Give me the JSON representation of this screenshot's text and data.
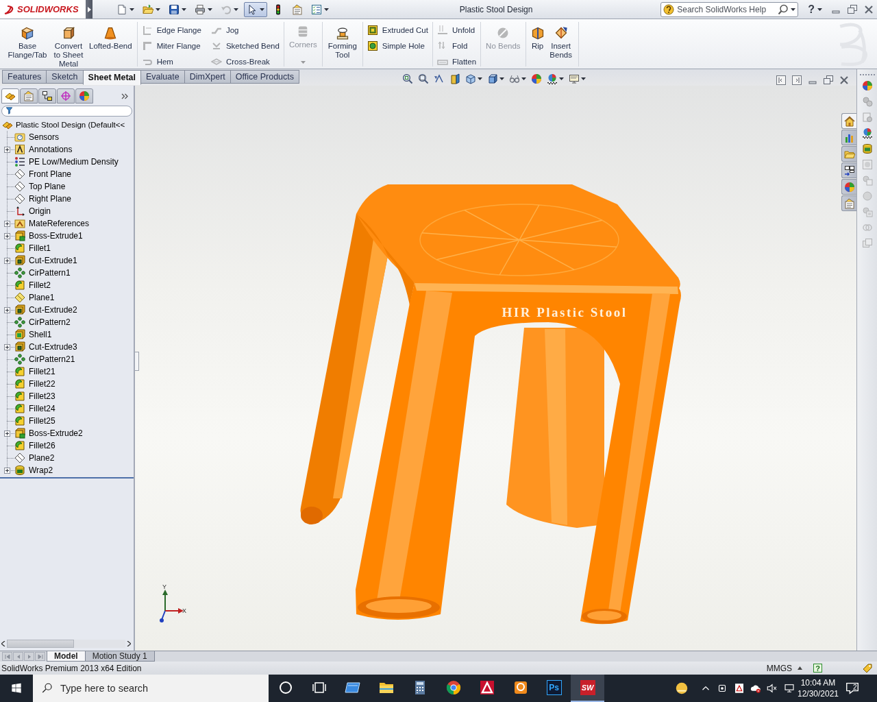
{
  "title_bar": {
    "logo": "SOLIDWORKS",
    "title": "Plastic Stool Design",
    "search": {
      "placeholder": "Search SolidWorks Help"
    },
    "help": "?",
    "quick_access": [
      {
        "kind": "new",
        "dropdown": true,
        "disabled": false,
        "pressed": false
      },
      {
        "kind": "open",
        "dropdown": true,
        "disabled": false,
        "pressed": false
      },
      {
        "kind": "save",
        "dropdown": true,
        "disabled": false,
        "pressed": false
      },
      {
        "kind": "print",
        "dropdown": true,
        "disabled": false,
        "pressed": false
      },
      {
        "kind": "undo",
        "dropdown": true,
        "disabled": true,
        "pressed": false
      },
      {
        "kind": "select",
        "dropdown": true,
        "disabled": false,
        "pressed": true
      },
      {
        "kind": "rebuild",
        "dropdown": false,
        "disabled": false,
        "pressed": false
      },
      {
        "kind": "properties",
        "dropdown": false,
        "disabled": false,
        "pressed": false
      },
      {
        "kind": "options",
        "dropdown": true,
        "disabled": false,
        "pressed": false
      }
    ]
  },
  "command_manager": {
    "groups": [
      {
        "kind": "large",
        "items": [
          {
            "kind": "base-flange",
            "label": "Base Flange/Tab",
            "disabled": false
          },
          {
            "kind": "convert",
            "label": "Convert to Sheet Metal",
            "disabled": false
          },
          {
            "kind": "lofted-bend",
            "label": "Lofted-Bend",
            "disabled": false
          }
        ]
      },
      {
        "kind": "small",
        "items": [
          {
            "kind": "edge-flange",
            "label": "Edge Flange",
            "disabled": true
          },
          {
            "kind": "miter-flange",
            "label": "Miter Flange",
            "disabled": true
          },
          {
            "kind": "hem",
            "label": "Hem",
            "disabled": true
          },
          {
            "kind": "jog",
            "label": "Jog",
            "disabled": true
          },
          {
            "kind": "sketched-bend",
            "label": "Sketched Bend",
            "disabled": true
          },
          {
            "kind": "cross-break",
            "label": "Cross-Break",
            "disabled": true
          }
        ]
      },
      {
        "kind": "flyout",
        "items": [
          {
            "kind": "corners",
            "label": "Corners",
            "disabled": true
          }
        ]
      },
      {
        "kind": "large",
        "items": [
          {
            "kind": "forming-tool",
            "label": "Forming Tool",
            "disabled": false
          }
        ]
      },
      {
        "kind": "small",
        "items": [
          {
            "kind": "extruded-cut",
            "label": "Extruded Cut",
            "disabled": false
          },
          {
            "kind": "simple-hole",
            "label": "Simple Hole",
            "disabled": false
          }
        ]
      },
      {
        "kind": "small",
        "items": [
          {
            "kind": "unfold",
            "label": "Unfold",
            "disabled": true
          },
          {
            "kind": "fold",
            "label": "Fold",
            "disabled": true
          },
          {
            "kind": "flatten",
            "label": "Flatten",
            "disabled": true
          }
        ]
      },
      {
        "kind": "large",
        "items": [
          {
            "kind": "no-bends",
            "label": "No Bends",
            "disabled": true
          }
        ]
      },
      {
        "kind": "large",
        "items": [
          {
            "kind": "rip",
            "label": "Rip",
            "disabled": false
          },
          {
            "kind": "insert-bends",
            "label": "Insert Bends",
            "disabled": false
          }
        ]
      }
    ]
  },
  "tabs": [
    {
      "label": "Features",
      "selected": false
    },
    {
      "label": "Sketch",
      "selected": false
    },
    {
      "label": "Sheet Metal",
      "selected": true
    },
    {
      "label": "Evaluate",
      "selected": false
    },
    {
      "label": "DimXpert",
      "selected": false
    },
    {
      "label": "Office Products",
      "selected": false
    }
  ],
  "view_toolbar": [
    {
      "kind": "zoom-fit",
      "dropdown": false
    },
    {
      "kind": "zoom-area",
      "dropdown": false
    },
    {
      "kind": "previous-view",
      "dropdown": false
    },
    {
      "kind": "section-view",
      "dropdown": false
    },
    {
      "kind": "view-orientation",
      "dropdown": true
    },
    {
      "kind": "display-style",
      "dropdown": true
    },
    {
      "kind": "hide-show",
      "dropdown": true
    },
    {
      "kind": "edit-appearance",
      "dropdown": false
    },
    {
      "kind": "apply-scene",
      "dropdown": true
    },
    {
      "kind": "view-settings",
      "dropdown": true
    }
  ],
  "viewport_controls": [
    {
      "kind": "tile-left"
    },
    {
      "kind": "tile-right"
    },
    {
      "kind": "minimize"
    },
    {
      "kind": "restore"
    },
    {
      "kind": "close"
    }
  ],
  "feature_manager": {
    "tabs": [
      {
        "kind": "feature-tree",
        "selected": true
      },
      {
        "kind": "property-manager",
        "selected": false
      },
      {
        "kind": "configuration-manager",
        "selected": false
      },
      {
        "kind": "dimxpert-manager",
        "selected": false
      },
      {
        "kind": "display-manager",
        "selected": false
      }
    ],
    "tree": {
      "label": "Plastic Stool Design (Default<<",
      "kind": "part",
      "children": [
        {
          "label": "Sensors",
          "kind": "sensors",
          "expandable": false
        },
        {
          "label": "Annotations",
          "kind": "annotations",
          "expandable": true
        },
        {
          "label": "PE Low/Medium Density",
          "kind": "material",
          "expandable": false
        },
        {
          "label": "Front Plane",
          "kind": "plane",
          "expandable": false
        },
        {
          "label": "Top Plane",
          "kind": "plane",
          "expandable": false
        },
        {
          "label": "Right Plane",
          "kind": "plane",
          "expandable": false
        },
        {
          "label": "Origin",
          "kind": "origin",
          "expandable": false
        },
        {
          "label": "MateReferences",
          "kind": "mate-references",
          "expandable": true
        },
        {
          "label": "Boss-Extrude1",
          "kind": "boss",
          "expandable": true
        },
        {
          "label": "Fillet1",
          "kind": "fillet",
          "expandable": false
        },
        {
          "label": "Cut-Extrude1",
          "kind": "cut",
          "expandable": true
        },
        {
          "label": "CirPattern1",
          "kind": "pattern",
          "expandable": false
        },
        {
          "label": "Fillet2",
          "kind": "fillet",
          "expandable": false
        },
        {
          "label": "Plane1",
          "kind": "shown-plane",
          "expandable": false
        },
        {
          "label": "Cut-Extrude2",
          "kind": "cut",
          "expandable": true
        },
        {
          "label": "CirPattern2",
          "kind": "pattern",
          "expandable": false
        },
        {
          "label": "Shell1",
          "kind": "shell",
          "expandable": false
        },
        {
          "label": "Cut-Extrude3",
          "kind": "cut",
          "expandable": true
        },
        {
          "label": "CirPattern21",
          "kind": "pattern",
          "expandable": false
        },
        {
          "label": "Fillet21",
          "kind": "fillet",
          "expandable": false
        },
        {
          "label": "Fillet22",
          "kind": "fillet",
          "expandable": false
        },
        {
          "label": "Fillet23",
          "kind": "fillet",
          "expandable": false
        },
        {
          "label": "Fillet24",
          "kind": "fillet",
          "expandable": false
        },
        {
          "label": "Fillet25",
          "kind": "fillet",
          "expandable": false
        },
        {
          "label": "Boss-Extrude2",
          "kind": "boss",
          "expandable": true
        },
        {
          "label": "Fillet26",
          "kind": "fillet",
          "expandable": false
        },
        {
          "label": "Plane2",
          "kind": "plane",
          "expandable": false
        },
        {
          "label": "Wrap2",
          "kind": "wrap",
          "expandable": true
        }
      ]
    }
  },
  "graphics_area": {
    "model_label": "HIR Plastic Stool",
    "triad": {
      "x_label": "X",
      "y_label": "Y"
    }
  },
  "task_pane": {
    "tabs": [
      {
        "kind": "home",
        "selected": true
      },
      {
        "kind": "library",
        "selected": false
      },
      {
        "kind": "folder",
        "selected": false
      },
      {
        "kind": "view-palette",
        "selected": false
      },
      {
        "kind": "appearance",
        "selected": false
      },
      {
        "kind": "custom-properties",
        "selected": false
      }
    ]
  },
  "right_toolbar": [
    {
      "kind": "appearance",
      "disabled": false
    },
    {
      "kind": "gears",
      "disabled": true
    },
    {
      "kind": "document-gear",
      "disabled": true
    },
    {
      "kind": "scene",
      "disabled": false
    },
    {
      "kind": "database",
      "disabled": false
    },
    {
      "kind": "render-region",
      "disabled": true
    },
    {
      "kind": "preview",
      "disabled": true
    },
    {
      "kind": "sphere",
      "disabled": true
    },
    {
      "kind": "layers",
      "disabled": true
    },
    {
      "kind": "link",
      "disabled": true
    },
    {
      "kind": "copy",
      "disabled": true
    }
  ],
  "bottom_tabs": [
    {
      "label": "Model",
      "selected": true
    },
    {
      "label": "Motion Study 1",
      "selected": false
    }
  ],
  "status_bar": {
    "text": "SolidWorks Premium 2013 x64 Edition",
    "units": "MMGS",
    "help": "?"
  },
  "taskbar": {
    "search": {
      "placeholder": "Type here to search"
    },
    "apps": [
      {
        "kind": "cortana",
        "active": false
      },
      {
        "kind": "task-view",
        "active": false
      },
      {
        "kind": "app-window",
        "active": false
      },
      {
        "kind": "file-explorer",
        "active": false
      },
      {
        "kind": "calculator",
        "active": false
      },
      {
        "kind": "browser",
        "active": false
      },
      {
        "kind": "cad",
        "active": false
      },
      {
        "kind": "ring-app",
        "active": false
      },
      {
        "kind": "tile",
        "glyph": "Ps",
        "active": false
      },
      {
        "kind": "red-tile",
        "glyph": "SW",
        "active": true
      }
    ],
    "tray": [
      {
        "kind": "weather"
      },
      {
        "kind": "chevron"
      },
      {
        "kind": "camera"
      },
      {
        "kind": "pdf"
      },
      {
        "kind": "cloud-error"
      },
      {
        "kind": "speaker-muted"
      },
      {
        "kind": "network"
      }
    ],
    "time": "10:04 AM",
    "date": "12/30/2021",
    "notifications": "2"
  }
}
